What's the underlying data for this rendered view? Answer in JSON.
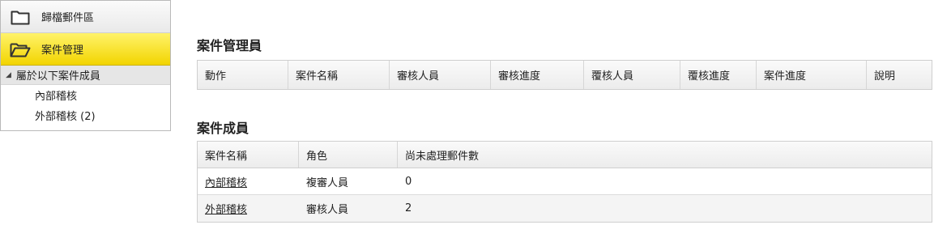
{
  "sidebar": {
    "items": [
      {
        "label": "歸檔郵件區",
        "icon": "folder-closed-icon"
      },
      {
        "label": "案件管理",
        "icon": "folder-open-icon",
        "active": true
      }
    ],
    "group": {
      "label": "屬於以下案件成員",
      "items": [
        {
          "label": "內部稽核"
        },
        {
          "label": "外部稽核 (2)"
        }
      ]
    }
  },
  "admin_section": {
    "title": "案件管理員",
    "columns": [
      "動作",
      "案件名稱",
      "審核人員",
      "審核進度",
      "覆核人員",
      "覆核進度",
      "案件進度",
      "說明"
    ]
  },
  "members_section": {
    "title": "案件成員",
    "columns": [
      "案件名稱",
      "角色",
      "尚未處理郵件數"
    ],
    "rows": [
      {
        "case": "內部稽核",
        "role": "複審人員",
        "pending": "0"
      },
      {
        "case": "外部稽核",
        "role": "審核人員",
        "pending": "2"
      }
    ]
  },
  "colors": {
    "active_item": "#f7e21c",
    "header_bg": "#ececec",
    "border": "#cfcfcf"
  }
}
